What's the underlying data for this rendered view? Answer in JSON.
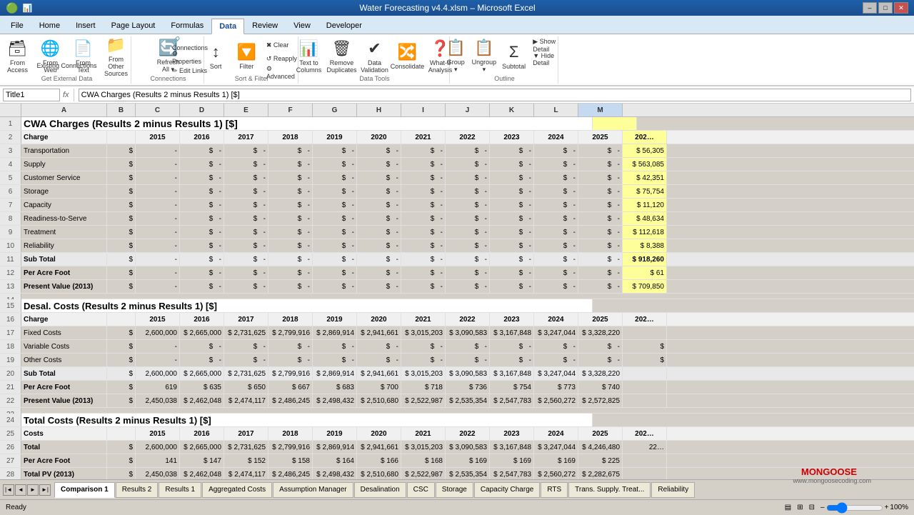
{
  "titleBar": {
    "title": "Water Forecasting v4.4.xlsm – Microsoft Excel",
    "controls": [
      "–",
      "□",
      "✕"
    ]
  },
  "ribbon": {
    "tabs": [
      "File",
      "Home",
      "Insert",
      "Page Layout",
      "Formulas",
      "Data",
      "Review",
      "View",
      "Developer"
    ],
    "activeTab": "Data",
    "groups": [
      {
        "label": "Get External Data",
        "buttons": [
          {
            "icon": "🗃",
            "label": "From\nAccess"
          },
          {
            "icon": "🌐",
            "label": "From\nWeb"
          },
          {
            "icon": "📄",
            "label": "From\nText"
          },
          {
            "icon": "📁",
            "label": "From Other\nSources"
          }
        ],
        "smallButtons": [
          "Existing Connections"
        ]
      },
      {
        "label": "Connections",
        "smallButtons": [
          "Connections",
          "Properties",
          "Edit Links"
        ],
        "buttons": [
          {
            "icon": "🔄",
            "label": "Refresh\nAll"
          }
        ]
      },
      {
        "label": "Sort & Filter",
        "buttons": [
          {
            "icon": "↕",
            "label": "Sort"
          },
          {
            "icon": "🔽",
            "label": "Filter"
          },
          {
            "icon": "✖",
            "label": "Clear"
          },
          {
            "icon": "↺",
            "label": "Reapply"
          },
          {
            "icon": "⚙",
            "label": "Advanced"
          }
        ]
      },
      {
        "label": "Data Tools",
        "buttons": [
          {
            "icon": "📊",
            "label": "Text to\nColumns"
          },
          {
            "icon": "🗑",
            "label": "Remove\nDuplicates"
          },
          {
            "icon": "✔",
            "label": "Data\nValidation"
          },
          {
            "icon": "🔀",
            "label": "Consolidate"
          },
          {
            "icon": "❓",
            "label": "What-If\nAnalysis"
          }
        ]
      },
      {
        "label": "Outline",
        "buttons": [
          {
            "icon": "📋",
            "label": "Group"
          },
          {
            "icon": "📋",
            "label": "Ungroup"
          },
          {
            "icon": "📋",
            "label": "Subtotal"
          }
        ],
        "smallButtons": [
          "Show Detail",
          "Hide Detail"
        ]
      }
    ]
  },
  "formulaBar": {
    "nameBox": "Title1",
    "formula": "CWA Charges (Results 2 minus Results 1) [$]"
  },
  "columns": {
    "widths": [
      30,
      120,
      60,
      70,
      70,
      70,
      70,
      70,
      70,
      70,
      70,
      70,
      70,
      70,
      70,
      60
    ],
    "headers": [
      "",
      "A",
      "B",
      "C",
      "D",
      "E",
      "F",
      "G",
      "H",
      "I",
      "J",
      "K",
      "L",
      "M"
    ]
  },
  "years": [
    "2015",
    "2016",
    "2017",
    "2018",
    "2019",
    "2020",
    "2021",
    "2022",
    "2023",
    "2024",
    "2025",
    "202"
  ],
  "section1": {
    "title": "CWA Charges (Results 2 minus Results 1) [$]",
    "row": 1,
    "headerRow": {
      "label": "Charge",
      "years": [
        "2015",
        "2016",
        "2017",
        "2018",
        "2019",
        "2020",
        "2021",
        "2022",
        "2023",
        "2024",
        "2025",
        "202"
      ]
    },
    "rows": [
      {
        "num": 3,
        "label": "Transportation",
        "vals": [
          "-",
          "-",
          "-",
          "-",
          "-",
          "-",
          "-",
          "-",
          "-",
          "-",
          "-",
          "56,305"
        ],
        "highlight": true
      },
      {
        "num": 4,
        "label": "Supply",
        "vals": [
          "-",
          "-",
          "-",
          "-",
          "-",
          "-",
          "-",
          "-",
          "-",
          "-",
          "-",
          "563,085"
        ],
        "highlight": true
      },
      {
        "num": 5,
        "label": "Customer Service",
        "vals": [
          "-",
          "-",
          "-",
          "-",
          "-",
          "-",
          "-",
          "-",
          "-",
          "-",
          "-",
          "42,351"
        ],
        "highlight": true
      },
      {
        "num": 6,
        "label": "Storage",
        "vals": [
          "-",
          "-",
          "-",
          "-",
          "-",
          "-",
          "-",
          "-",
          "-",
          "-",
          "-",
          "75,754"
        ],
        "highlight": true
      },
      {
        "num": 7,
        "label": "Capacity",
        "vals": [
          "-",
          "-",
          "-",
          "-",
          "-",
          "-",
          "-",
          "-",
          "-",
          "-",
          "-",
          "11,120"
        ],
        "highlight": true
      },
      {
        "num": 8,
        "label": "Readiness-to-Serve",
        "vals": [
          "-",
          "-",
          "-",
          "-",
          "-",
          "-",
          "-",
          "-",
          "-",
          "-",
          "-",
          "48,634"
        ],
        "highlight": true
      },
      {
        "num": 9,
        "label": "Treatment",
        "vals": [
          "-",
          "-",
          "-",
          "-",
          "-",
          "-",
          "-",
          "-",
          "-",
          "-",
          "-",
          "112,618"
        ],
        "highlight": true
      },
      {
        "num": 10,
        "label": "Reliability",
        "vals": [
          "-",
          "-",
          "-",
          "-",
          "-",
          "-",
          "-",
          "-",
          "-",
          "-",
          "-",
          "8,388"
        ],
        "highlight": true
      },
      {
        "num": 11,
        "label": "Sub Total",
        "vals": [
          "-",
          "-",
          "-",
          "-",
          "-",
          "-",
          "-",
          "-",
          "-",
          "-",
          "-",
          "918,260"
        ],
        "subtotal": true,
        "highlight": true
      },
      {
        "num": 12,
        "label": "Per Acre Foot",
        "vals": [
          "-",
          "-",
          "-",
          "-",
          "-",
          "-",
          "-",
          "-",
          "-",
          "-",
          "-",
          "61"
        ],
        "highlight": true
      },
      {
        "num": 13,
        "label": "Present Value (2013)",
        "vals": [
          "-",
          "-",
          "-",
          "-",
          "-",
          "-",
          "-",
          "-",
          "-",
          "-",
          "-",
          "709,850"
        ],
        "highlight": true
      }
    ]
  },
  "section2": {
    "title": "Desal. Costs (Results 2 minus Results 1) [$]",
    "row": 15,
    "headerRow": {
      "label": "Charge",
      "years": [
        "2015",
        "2016",
        "2017",
        "2018",
        "2019",
        "2020",
        "2021",
        "2022",
        "2023",
        "2024",
        "2025",
        "202"
      ]
    },
    "rows": [
      {
        "num": 17,
        "label": "Fixed Costs",
        "vals": [
          "2,600,000",
          "2,665,000",
          "2,731,625",
          "2,799,916",
          "2,869,914",
          "2,941,661",
          "3,015,203",
          "3,090,583",
          "3,167,848",
          "3,247,044",
          "3,328,220"
        ]
      },
      {
        "num": 18,
        "label": "Variable Costs",
        "vals": [
          "-",
          "-",
          "-",
          "-",
          "-",
          "-",
          "-",
          "-",
          "-",
          "-",
          "-"
        ]
      },
      {
        "num": 19,
        "label": "Other Costs",
        "vals": [
          "-",
          "-",
          "-",
          "-",
          "-",
          "-",
          "-",
          "-",
          "-",
          "-",
          "-"
        ]
      },
      {
        "num": 20,
        "label": "Sub Total",
        "vals": [
          "2,600,000",
          "2,665,000",
          "2,731,625",
          "2,799,916",
          "2,869,914",
          "2,941,661",
          "3,015,203",
          "3,090,583",
          "3,167,848",
          "3,247,044",
          "3,328,220"
        ],
        "subtotal": true
      },
      {
        "num": 21,
        "label": "Per Acre Foot",
        "vals": [
          "619",
          "635",
          "650",
          "667",
          "683",
          "700",
          "718",
          "736",
          "754",
          "773",
          "740"
        ]
      },
      {
        "num": 22,
        "label": "Present Value (2013)",
        "vals": [
          "2,450,038",
          "2,462,048",
          "2,474,117",
          "2,486,245",
          "2,498,432",
          "2,510,680",
          "2,522,987",
          "2,535,354",
          "2,547,783",
          "2,560,272",
          "2,572,825"
        ]
      }
    ]
  },
  "section3": {
    "title": "Total Costs (Results 2 minus Results 1) [$]",
    "row": 24,
    "headerRow": {
      "label": "Costs",
      "years": [
        "2015",
        "2016",
        "2017",
        "2018",
        "2019",
        "2020",
        "2021",
        "2022",
        "2023",
        "2024",
        "2025",
        "202"
      ]
    },
    "rows": [
      {
        "num": 26,
        "label": "Total",
        "vals": [
          "2,600,000",
          "2,665,000",
          "2,731,625",
          "2,799,916",
          "2,869,914",
          "2,941,661",
          "3,015,203",
          "3,090,583",
          "3,167,848",
          "3,247,044",
          "4,246,480"
        ]
      },
      {
        "num": 27,
        "label": "Per Acre Foot",
        "vals": [
          "141",
          "147",
          "152",
          "158",
          "164",
          "166",
          "168",
          "169",
          "169",
          "169",
          "225"
        ]
      },
      {
        "num": 28,
        "label": "Total PV (2013)",
        "vals": [
          "2,450,038",
          "2,462,048",
          "2,474,117",
          "2,486,245",
          "2,498,432",
          "2,510,680",
          "2,522,987",
          "2,535,354",
          "2,547,783",
          "2,560,272",
          "2,282,675"
        ]
      }
    ]
  },
  "sheetTabs": [
    "Comparison 1",
    "Results 2",
    "Results 1",
    "Aggregated Costs",
    "Assumption Manager",
    "Desalination",
    "CSC",
    "Storage",
    "Capacity Charge",
    "RTS",
    "Trans. Supply. Treat...",
    "Reliability"
  ],
  "activeSheet": "Comparison 1",
  "status": {
    "left": "Ready",
    "zoom": "100%"
  },
  "watermark": {
    "brand": "MONGOOSE",
    "url": "www.mongoosecoding.com"
  }
}
